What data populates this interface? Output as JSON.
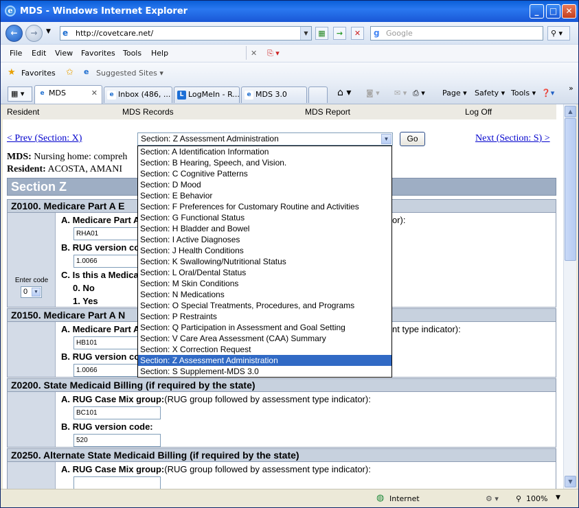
{
  "window": {
    "title": "MDS - Windows Internet Explorer",
    "min": "_",
    "max": "□",
    "close": "✕"
  },
  "address": {
    "url": "http://covetcare.net/",
    "search_placeholder": "Google"
  },
  "menu": [
    "File",
    "Edit",
    "View",
    "Favorites",
    "Tools",
    "Help"
  ],
  "favorites": {
    "label": "Favorites",
    "suggested": "Suggested Sites ▾"
  },
  "tabs": [
    {
      "label": "MDS",
      "active": true
    },
    {
      "label": "Inbox (486, ..."
    },
    {
      "label": "LogMeIn - R..."
    },
    {
      "label": "MDS 3.0"
    }
  ],
  "commands": {
    "page": "Page ▾",
    "safety": "Safety ▾",
    "tools": "Tools ▾"
  },
  "nav": {
    "resident": "Resident",
    "mds_records": "MDS Records",
    "mds_report": "MDS Report",
    "logoff": "Log Off"
  },
  "pager": {
    "prev": "< Prev (Section: X)",
    "next": "Next (Section: S) >",
    "selected": "Section: Z Assessment Administration",
    "go": "Go"
  },
  "meta": {
    "mds_label": "MDS:",
    "mds_value": " Nursing home: compreh",
    "resident_label": "Resident:",
    "resident_value": " ACOSTA, AMANI"
  },
  "section_title": "Section Z",
  "dropdown_options": [
    "Section: A Identification Information",
    "Section: B Hearing, Speech, and Vision.",
    "Section: C Cognitive Patterns",
    "Section: D Mood",
    "Section: E Behavior",
    "Section: F Preferences for Customary Routine and Activities",
    "Section: G Functional Status",
    "Section: H Bladder and Bowel",
    "Section: I Active Diagnoses",
    "Section: J Health Conditions",
    "Section: K Swallowing/Nutritional Status",
    "Section: L Oral/Dental Status",
    "Section: M Skin Conditions",
    "Section: N Medications",
    "Section: O Special Treatments, Procedures, and Programs",
    "Section: P Restraints",
    "Section: Q Participation in Assessment and Goal Setting",
    "Section: V Care Area Assessment (CAA) Summary",
    "Section: X Correction Request",
    "Section: Z Assessment Administration",
    "Section: S Supplement-MDS 3.0"
  ],
  "dropdown_selected_index": 19,
  "items": {
    "z0100": {
      "header": "Z0100. Medicare Part A E",
      "a_label": "A. Medicare Part A",
      "a_suffix": "or):",
      "a_value": "RHA01",
      "b_label": "B. RUG version co",
      "b_value": "1.0066",
      "c_label": "C. Is this a Medica",
      "opt0": "0. No",
      "opt1": "1. Yes",
      "enter_code": "Enter code",
      "code_value": "0"
    },
    "z0150": {
      "header": "Z0150. Medicare Part A N",
      "a_label": "A. Medicare Part A",
      "a_suffix": "nt type indicator):",
      "a_value": "HB101",
      "b_label": "B. RUG version co",
      "b_value": "1.0066"
    },
    "z0200": {
      "header": "Z0200. State Medicaid Billing (if required by the state)",
      "a_label": "A. RUG Case Mix group:",
      "a_desc": "(RUG group followed by assessment type indicator):",
      "a_value": "BC101",
      "b_label": "B. RUG version code:",
      "b_value": "520"
    },
    "z0250": {
      "header": "Z0250. Alternate State Medicaid Billing (if required by the state)",
      "a_label": "A. RUG Case Mix group:",
      "a_desc": "(RUG group followed by assessment type indicator):",
      "a_value": ""
    }
  },
  "status": {
    "zone": "Internet",
    "zoom": "100%"
  }
}
